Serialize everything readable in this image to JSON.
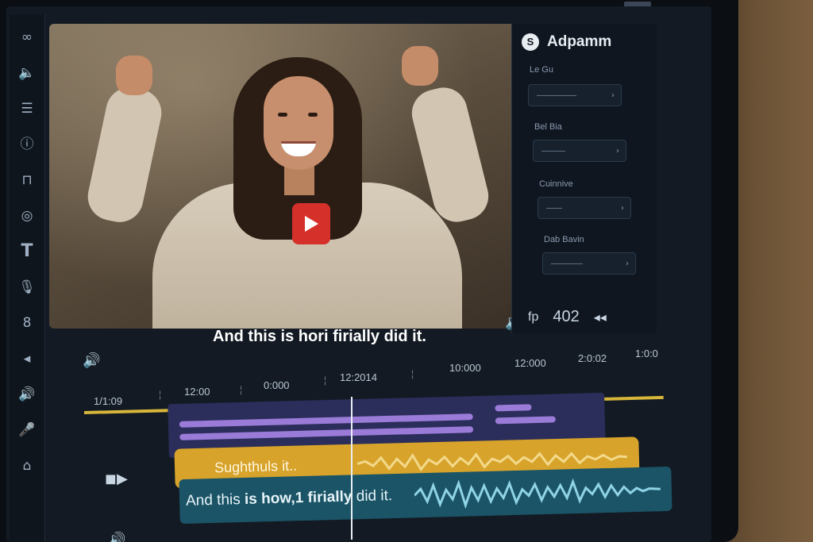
{
  "toolbar": {
    "tools": [
      {
        "name": "link-tool",
        "glyph": "∞"
      },
      {
        "name": "audio-tool",
        "glyph": "🔈"
      },
      {
        "name": "menu-tool",
        "glyph": "☰"
      },
      {
        "name": "info-tool",
        "glyph": "ⓘ"
      },
      {
        "name": "transition-tool",
        "glyph": "⊓"
      },
      {
        "name": "effects-tool",
        "glyph": "◎"
      },
      {
        "name": "text-tool",
        "glyph": "T"
      },
      {
        "name": "mic-tool",
        "glyph": "🎙"
      },
      {
        "name": "speed-tool",
        "glyph": "8"
      },
      {
        "name": "sound-tool",
        "glyph": "◂"
      },
      {
        "name": "volume-tool",
        "glyph": "🔊"
      },
      {
        "name": "mic2-tool",
        "glyph": "🎤"
      },
      {
        "name": "pin-tool",
        "glyph": "⌂"
      }
    ]
  },
  "preview": {
    "caption": "And this is hori firially did it."
  },
  "panel": {
    "title": "Adpamm",
    "logo": "S",
    "fields": [
      {
        "label": "Le Gu",
        "value": "—————"
      },
      {
        "label": "Bel Bia",
        "value": "———"
      },
      {
        "label": "Cuinnive",
        "value": "——"
      },
      {
        "label": "Dab Bavin",
        "value": "————"
      }
    ],
    "footer": {
      "left": "fp",
      "value": "402",
      "right": "◂◂"
    }
  },
  "timeline": {
    "ticks": [
      "1/1:09",
      "12:00",
      "0:000",
      "12:2014",
      "10:000",
      "12:000",
      "2:0:02",
      "1:0:0"
    ],
    "caption_track_text": "Sughthuls it..",
    "audio_track_text_start": "And this ",
    "audio_track_text_bold": "is how,1 firially",
    "audio_track_text_end": " did it."
  }
}
